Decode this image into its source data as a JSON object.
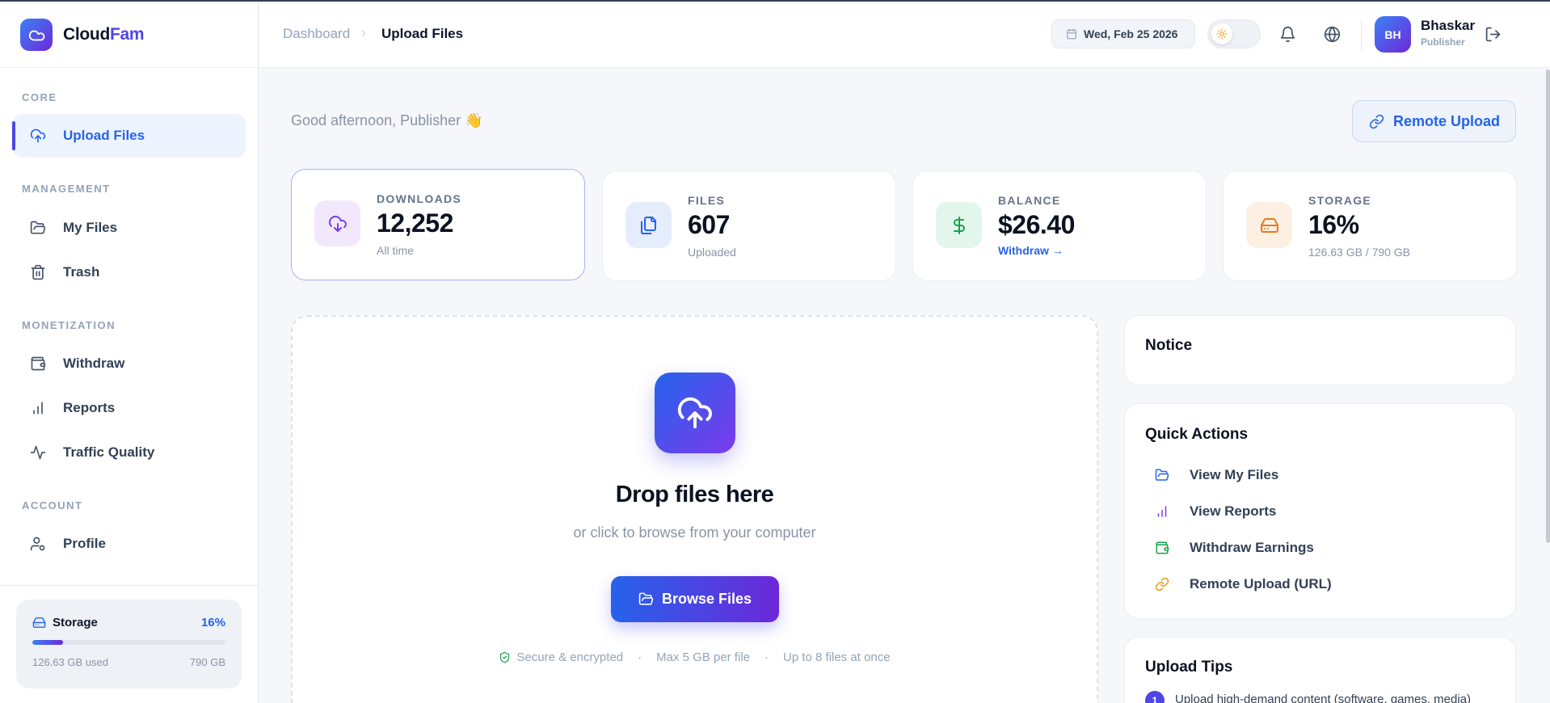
{
  "brand": {
    "name_main": "Cloud",
    "name_accent": "Fam"
  },
  "sidebar": {
    "sections": {
      "core": "CORE",
      "management": "MANAGEMENT",
      "monetization": "MONETIZATION",
      "account": "ACCOUNT"
    },
    "items": [
      {
        "label": "Upload Files",
        "icon": "upload-cloud-icon",
        "active": true
      },
      {
        "label": "My Files",
        "icon": "folder-icon"
      },
      {
        "label": "Trash",
        "icon": "trash-icon"
      },
      {
        "label": "Withdraw",
        "icon": "wallet-icon"
      },
      {
        "label": "Reports",
        "icon": "bar-chart-icon"
      },
      {
        "label": "Traffic Quality",
        "icon": "activity-icon"
      },
      {
        "label": "Profile",
        "icon": "user-icon"
      }
    ],
    "storage": {
      "title": "Storage",
      "percent": "16%",
      "fill": 0.16,
      "used": "126.63 GB used",
      "total": "790 GB"
    }
  },
  "header": {
    "breadcrumb": {
      "parent": "Dashboard",
      "current": "Upload Files"
    },
    "date": "Wed, Feb 25 2026",
    "user": {
      "initials": "BH",
      "name": "Bhaskar",
      "role": "Publisher"
    }
  },
  "main": {
    "greeting": "Good afternoon, Publisher 👋",
    "remote_upload_label": "Remote Upload",
    "stats": [
      {
        "label": "DOWNLOADS",
        "value": "12,252",
        "sub": "All time"
      },
      {
        "label": "FILES",
        "value": "607",
        "sub": "Uploaded"
      },
      {
        "label": "BALANCE",
        "value": "$26.40",
        "sub": "Withdraw →"
      },
      {
        "label": "STORAGE",
        "value": "16%",
        "sub": "126.63 GB / 790 GB"
      }
    ],
    "dropzone": {
      "title": "Drop files here",
      "subtitle": "or click to browse from your computer",
      "button": "Browse Files",
      "info_secure": "Secure & encrypted",
      "info_max": "Max 5 GB per file",
      "info_count": "Up to 8 files at once",
      "separator": "·"
    },
    "notice": {
      "title": "Notice"
    },
    "quick_actions": {
      "title": "Quick Actions",
      "items": [
        "View My Files",
        "View Reports",
        "Withdraw Earnings",
        "Remote Upload (URL)"
      ]
    },
    "upload_tips": {
      "title": "Upload Tips",
      "tip_number": "1",
      "tip_1": "Upload high-demand content (software, games, media)"
    }
  },
  "colors": {
    "accent": "#2563eb",
    "brand_gradient_start": "#3b82f6",
    "brand_gradient_end": "#6d28d9",
    "success": "#16a34a",
    "warning": "#ea9a1b"
  }
}
